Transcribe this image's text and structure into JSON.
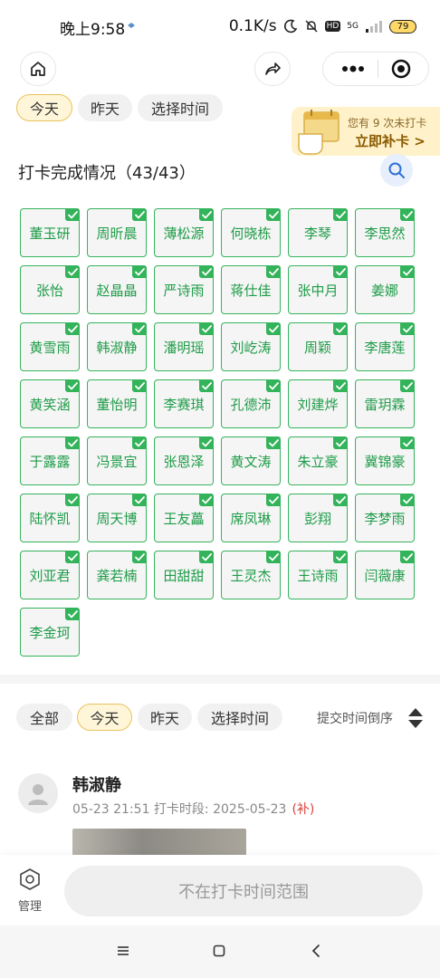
{
  "status_bar": {
    "time": "晚上9:58",
    "network_speed": "0.1K/s",
    "hd_badge": "HD",
    "network_type": "5G",
    "battery": "79"
  },
  "nav": {
    "home_icon": "home-icon",
    "share_icon": "share-icon",
    "more_icon": "more-dots-icon",
    "close_icon": "target-close-icon"
  },
  "top_filters": [
    "今天",
    "昨天",
    "选择时间"
  ],
  "top_filter_active": "今天",
  "banner": {
    "line1": "您有 9 次未打卡",
    "line2": "立即补卡 >"
  },
  "completion": {
    "title": "打卡完成情况（43/43）",
    "search_icon": "search-icon"
  },
  "members": [
    "董玉研",
    "周昕晨",
    "薄松源",
    "何晓栋",
    "李琴",
    "李思然",
    "张怡",
    "赵晶晶",
    "严诗雨",
    "蒋仕佳",
    "张中月",
    "姜娜",
    "黄雪雨",
    "韩淑静",
    "潘明瑶",
    "刘屹涛",
    "周颖",
    "李唐莲",
    "黄笑涵",
    "董怡明",
    "李赛琪",
    "孔德沛",
    "刘建烨",
    "雷玥霖",
    "于露露",
    "冯景宜",
    "张恩泽",
    "黄文涛",
    "朱立豪",
    "冀锦豪",
    "陆怀凯",
    "周天博",
    "王友藟",
    "席凤琳",
    "彭翔",
    "李梦雨",
    "刘亚君",
    "龚若楠",
    "田甜甜",
    "王灵杰",
    "王诗雨",
    "闫薇康",
    "李金珂"
  ],
  "list_filters": [
    "全部",
    "今天",
    "昨天",
    "选择时间"
  ],
  "list_filter_active": "今天",
  "sort_label": "提交时间倒序",
  "entry": {
    "name": "韩淑静",
    "meta": "05-23 21:51  打卡时段: 2025-05-23",
    "tag": "(补)"
  },
  "bottom": {
    "manage_label": "管理",
    "manage_icon": "hexagon-settings-icon",
    "range_button": "不在打卡时间范围"
  },
  "system_nav": {
    "menu_icon": "menu-icon",
    "home_icon": "square-home-icon",
    "back_icon": "back-chevron-icon"
  },
  "colors": {
    "accent_green": "#35b45c",
    "active_chip": "#fff6d9",
    "banner_bg": "#fff1c9",
    "tag_red": "#d9433a"
  }
}
